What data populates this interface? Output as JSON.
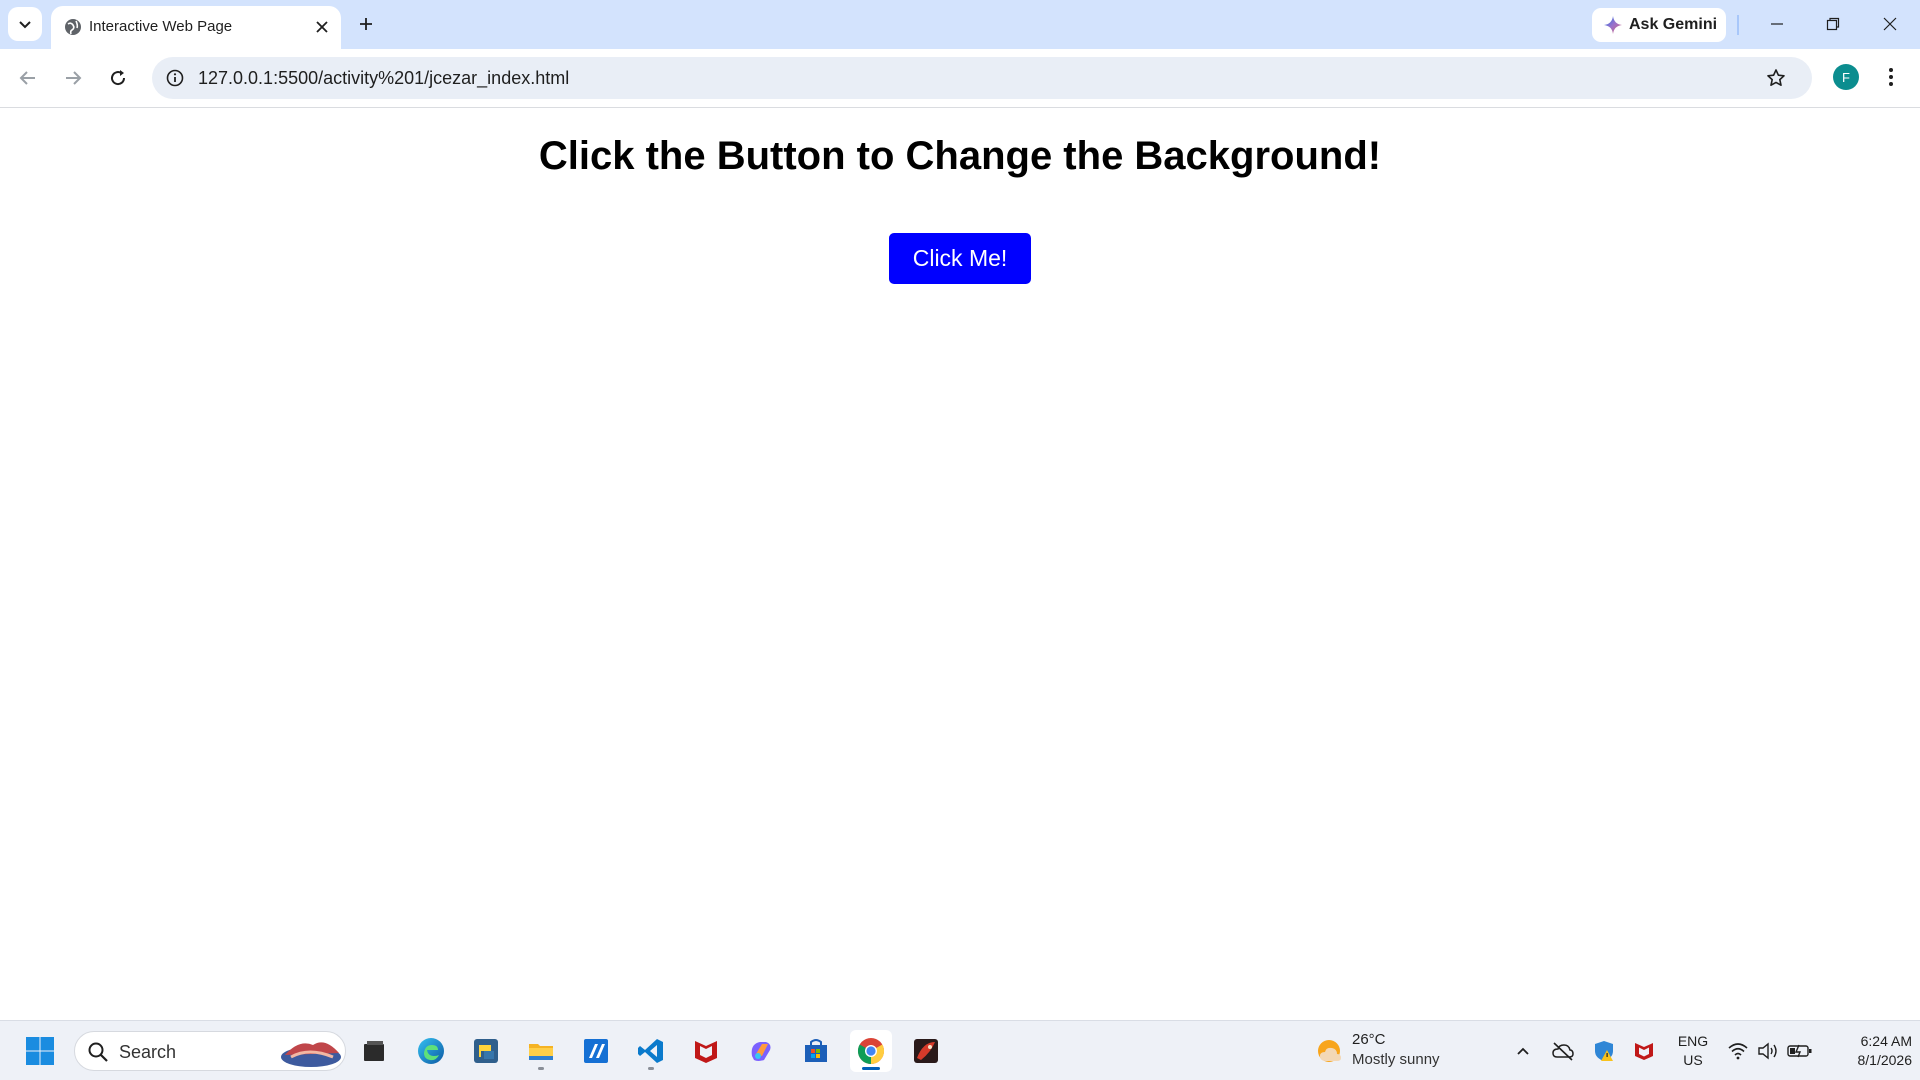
{
  "browser": {
    "tab": {
      "title": "Interactive Web Page"
    },
    "ask_gemini": "Ask Gemini",
    "url": "127.0.0.1:5500/activity%201/jcezar_index.html",
    "profile_initial": "F"
  },
  "page": {
    "heading": "Click the Button to Change the Background!",
    "button_label": "Click Me!",
    "background_color": "#ffffff",
    "button_color": "#0000ff"
  },
  "taskbar": {
    "search_label": "Search",
    "weather": {
      "temp": "26°C",
      "desc": "Mostly sunny"
    },
    "lang": {
      "line1": "ENG",
      "line2": "US"
    },
    "clock": {
      "time": "6:24 AM",
      "date": "8/1/2026"
    },
    "pinned_apps": [
      "start-icon",
      "file-explorer-dark-icon",
      "edge-icon",
      "python-icon",
      "folder-icon",
      "edit-app-icon",
      "vscode-icon",
      "mcafee-icon",
      "copilot-icon",
      "store-icon",
      "chrome-icon",
      "game-icon"
    ]
  },
  "colors": {
    "tabstrip": "#d3e3fd",
    "accent": "#005fb8"
  }
}
